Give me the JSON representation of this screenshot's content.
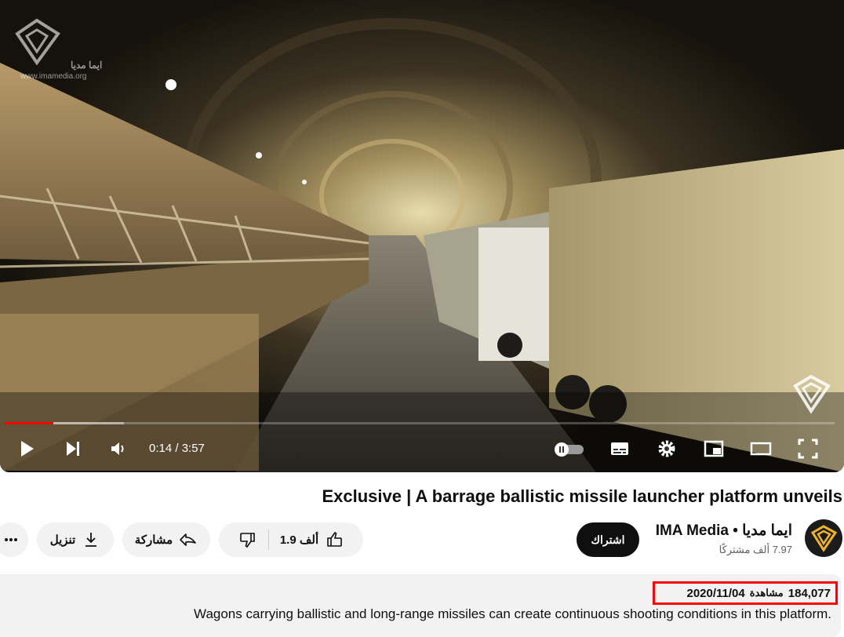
{
  "player": {
    "watermark": {
      "name": "ايما مديا",
      "url": "www.imamedia.org"
    },
    "time_display": "0:14 / 3:57",
    "progress_fraction": 0.059,
    "buffered_fraction": 0.144
  },
  "video": {
    "title": "Exclusive | A barrage ballistic missile launcher platform unveils"
  },
  "channel": {
    "name": "ايما مديا • IMA Media",
    "subscribers": "7.97 ألف مشتركًا",
    "subscribe_label": "اشتراك"
  },
  "actions": {
    "like_count": "1.9 ألف",
    "share_label": "مشاركة",
    "download_label": "تنزيل"
  },
  "description": {
    "views": "184,077",
    "views_unit": "مشاهدة",
    "date": "2020/11/04",
    "text": "Wagons carrying ballistic and long-range missiles can create continuous shooting conditions in this platform."
  },
  "colors": {
    "progress": "#ff0000",
    "highlight_box": "#ff0000",
    "subscribe_bg": "#0f0f0f"
  }
}
